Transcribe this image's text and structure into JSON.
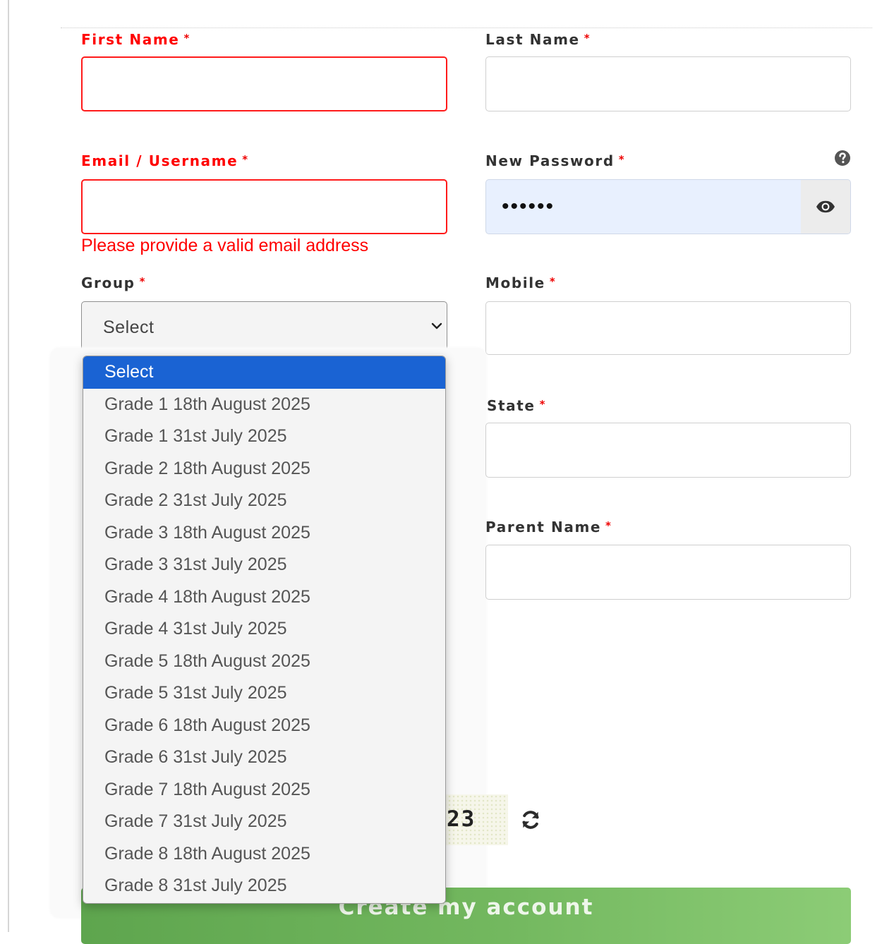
{
  "form": {
    "first_name": {
      "label": "First Name",
      "required_mark": "*",
      "value": ""
    },
    "last_name": {
      "label": "Last Name",
      "required_mark": "*",
      "value": ""
    },
    "email": {
      "label": "Email / Username",
      "required_mark": "*",
      "value": "",
      "error": "Please provide a valid email address"
    },
    "password": {
      "label": "New Password",
      "required_mark": "*",
      "value": "••••••"
    },
    "group": {
      "label": "Group",
      "required_mark": "*",
      "selected": "Select"
    },
    "mobile": {
      "label": "Mobile",
      "required_mark": "*",
      "value": ""
    },
    "state": {
      "label": "State",
      "required_mark": "*",
      "value": ""
    },
    "parent_name": {
      "label": "Parent Name",
      "required_mark": "*",
      "value": ""
    },
    "captcha": {
      "text": "23"
    },
    "submit_label": "Create my account"
  },
  "dropdown": {
    "options": [
      "Select",
      "Grade 1 18th August 2025",
      "Grade 1 31st July 2025",
      "Grade 2 18th August 2025",
      "Grade 2 31st July 2025",
      "Grade 3 18th August 2025",
      "Grade 3 31st July 2025",
      "Grade 4 18th August 2025",
      "Grade 4 31st July 2025",
      "Grade 5 18th August 2025",
      "Grade 5 31st July 2025",
      "Grade 6 18th August 2025",
      "Grade 6 31st July 2025",
      "Grade 7 18th August 2025",
      "Grade 7 31st July 2025",
      "Grade 8 18th August 2025",
      "Grade 8 31st July 2025"
    ],
    "highlighted_index": 0
  },
  "colors": {
    "error": "#ff0000",
    "dropdown_highlight": "#1a63d3",
    "password_fill": "#e8f0fe",
    "button_green": "#73b85f"
  },
  "icons": {
    "help": "question-circle-icon",
    "eye": "eye-icon",
    "chevron": "chevron-down-icon",
    "refresh": "refresh-icon"
  }
}
